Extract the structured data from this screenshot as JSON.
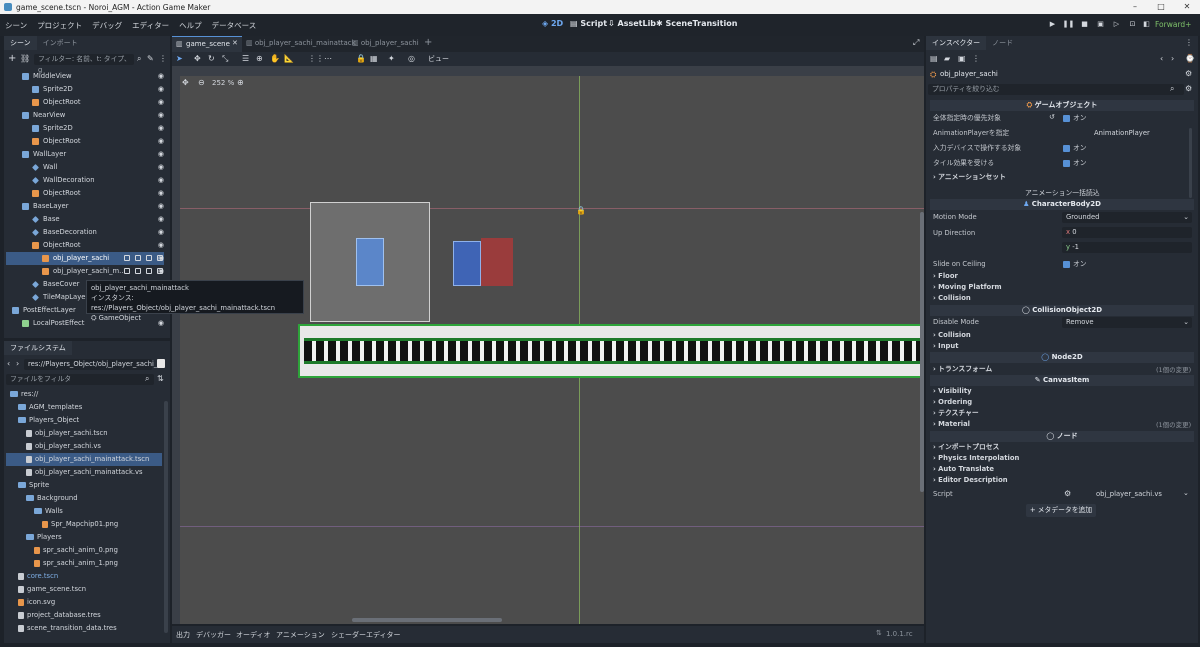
{
  "window": {
    "title": "game_scene.tscn - Noroi_AGM - Action Game Maker"
  },
  "menu": [
    "シーン",
    "プロジェクト",
    "デバッグ",
    "エディター",
    "ヘルプ",
    "データベース"
  ],
  "workspaces": [
    "2D",
    "Script",
    "AssetLib",
    "SceneTransition"
  ],
  "renderer": "Forward+",
  "scene_panel": {
    "tabs": [
      "シーン",
      "インポート"
    ],
    "filter_placeholder": "フィルター: 名前、t: タイプ、g",
    "nodes": [
      {
        "label": "MiddleView",
        "depth": 1,
        "type": "layer"
      },
      {
        "label": "Sprite2D",
        "depth": 2,
        "type": "sprite"
      },
      {
        "label": "ObjectRoot",
        "depth": 2,
        "type": "node"
      },
      {
        "label": "NearView",
        "depth": 1,
        "type": "layer"
      },
      {
        "label": "Sprite2D",
        "depth": 2,
        "type": "sprite"
      },
      {
        "label": "ObjectRoot",
        "depth": 2,
        "type": "node"
      },
      {
        "label": "WallLayer",
        "depth": 1,
        "type": "layer"
      },
      {
        "label": "Wall",
        "depth": 2,
        "type": "tilemap"
      },
      {
        "label": "WallDecoration",
        "depth": 2,
        "type": "tilemap"
      },
      {
        "label": "ObjectRoot",
        "depth": 2,
        "type": "node"
      },
      {
        "label": "BaseLayer",
        "depth": 1,
        "type": "layer"
      },
      {
        "label": "Base",
        "depth": 2,
        "type": "tilemap"
      },
      {
        "label": "BaseDecoration",
        "depth": 2,
        "type": "tilemap"
      },
      {
        "label": "ObjectRoot",
        "depth": 2,
        "type": "node"
      },
      {
        "label": "obj_player_sachi",
        "depth": 3,
        "type": "object",
        "selected": true
      },
      {
        "label": "obj_player_sachi_m...",
        "depth": 3,
        "type": "object"
      },
      {
        "label": "BaseCover",
        "depth": 2,
        "type": "tilemap"
      },
      {
        "label": "TileMapLayer",
        "depth": 2,
        "type": "tilemap"
      },
      {
        "label": "PostEffectLayer",
        "depth": 0,
        "type": "layer"
      },
      {
        "label": "LocalPostEffect",
        "depth": 1,
        "type": "effect"
      }
    ],
    "tooltip": {
      "line1": "obj_player_sachi_mainattack",
      "line2": "インスタンス: res://Players_Object/obj_player_sachi_mainattack.tscn",
      "line3": "GameObject"
    }
  },
  "filesystem": {
    "tab": "ファイルシステム",
    "path": "res://Players_Object/obj_player_sachi_m",
    "filter_placeholder": "ファイルをフィルタ",
    "items": [
      {
        "label": "res://",
        "depth": 0,
        "kind": "folder"
      },
      {
        "label": "AGM_templates",
        "depth": 1,
        "kind": "folder"
      },
      {
        "label": "Players_Object",
        "depth": 1,
        "kind": "folder"
      },
      {
        "label": "obj_player_sachi.tscn",
        "depth": 2,
        "kind": "scene"
      },
      {
        "label": "obj_player_sachi.vs",
        "depth": 2,
        "kind": "script"
      },
      {
        "label": "obj_player_sachi_mainattack.tscn",
        "depth": 2,
        "kind": "scene",
        "selected": true
      },
      {
        "label": "obj_player_sachi_mainattack.vs",
        "depth": 2,
        "kind": "script"
      },
      {
        "label": "Sprite",
        "depth": 1,
        "kind": "folder"
      },
      {
        "label": "Background",
        "depth": 2,
        "kind": "folder"
      },
      {
        "label": "Walls",
        "depth": 3,
        "kind": "folder"
      },
      {
        "label": "Spr_Mapchip01.png",
        "depth": 4,
        "kind": "image"
      },
      {
        "label": "Players",
        "depth": 2,
        "kind": "folder"
      },
      {
        "label": "spr_sachi_anim_0.png",
        "depth": 3,
        "kind": "image"
      },
      {
        "label": "spr_sachi_anim_1.png",
        "depth": 3,
        "kind": "image"
      },
      {
        "label": "core.tscn",
        "depth": 1,
        "kind": "scene"
      },
      {
        "label": "game_scene.tscn",
        "depth": 1,
        "kind": "scene"
      },
      {
        "label": "icon.svg",
        "depth": 1,
        "kind": "image"
      },
      {
        "label": "project_database.tres",
        "depth": 1,
        "kind": "resource"
      },
      {
        "label": "scene_transition_data.tres",
        "depth": 1,
        "kind": "resource"
      }
    ]
  },
  "editor": {
    "tabs": [
      "game_scene",
      "obj_player_sachi_mainattack",
      "obj_player_sachi"
    ],
    "view_menu": "ビュー",
    "zoom": "252 %"
  },
  "bottom_tabs": [
    "出力",
    "デバッガー",
    "オーディオ",
    "アニメーション",
    "シェーダーエディター"
  ],
  "version": "1.0.1.rc",
  "inspector": {
    "tabs": [
      "インスペクター",
      "ノード"
    ],
    "node": "obj_player_sachi",
    "filter_placeholder": "プロパティを絞り込む",
    "sections": {
      "game_object": "ゲームオブジェクト",
      "character_body": "CharacterBody2D",
      "collision_object": "CollisionObject2D",
      "node2d": "Node2D",
      "canvas_item": "CanvasItem",
      "node": "ノード"
    },
    "props": {
      "priority_label": "全体指定時の優先対象",
      "animplayer_label": "AnimationPlayerを指定",
      "animplayer_value": "AnimationPlayer",
      "input_label": "入力デバイスで操作する対象",
      "tile_label": "タイル効果を受ける",
      "on": "オン",
      "anim_set": "アニメーションセット",
      "anim_bulk": "アニメーション一括読込",
      "motion_mode_label": "Motion Mode",
      "motion_mode_value": "Grounded",
      "up_dir_label": "Up Direction",
      "up_x_label": "x",
      "up_x": "0",
      "up_y_label": "y",
      "up_y": "-1",
      "slide_label": "Slide on Ceiling",
      "floor": "Floor",
      "moving_platform": "Moving Platform",
      "collision": "Collision",
      "disable_mode_label": "Disable Mode",
      "disable_mode_value": "Remove",
      "collision2": "Collision",
      "input": "Input",
      "transform": "トランスフォーム",
      "transform_note": "(1個の変更)",
      "visibility": "Visibility",
      "ordering": "Ordering",
      "texture": "テクスチャー",
      "material": "Material",
      "material_note": "(1個の変更)",
      "import_process": "インポートプロセス",
      "physics_interp": "Physics Interpolation",
      "auto_translate": "Auto Translate",
      "editor_desc": "Editor Description",
      "script_label": "Script",
      "script_value": "obj_player_sachi.vs",
      "add_metadata": "メタデータを追加"
    }
  }
}
